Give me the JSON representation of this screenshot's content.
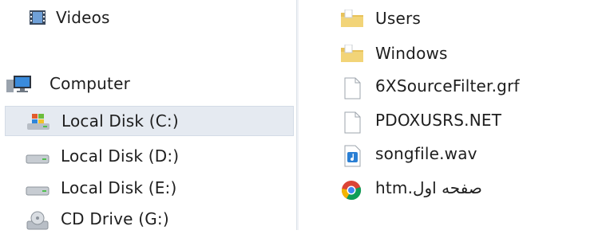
{
  "navigation": {
    "items": [
      {
        "label": "Videos",
        "icon": "videos-library-icon"
      },
      {
        "label": "Computer",
        "icon": "computer-icon"
      },
      {
        "label": "Local Disk (C:)",
        "icon": "windows-drive-icon",
        "selected": true
      },
      {
        "label": "Local Disk (D:)",
        "icon": "hard-drive-icon"
      },
      {
        "label": "Local Disk (E:)",
        "icon": "hard-drive-icon"
      },
      {
        "label": "CD Drive (G:)",
        "icon": "cd-drive-icon"
      }
    ]
  },
  "files": {
    "items": [
      {
        "name": "Users",
        "icon": "folder-icon"
      },
      {
        "name": "Windows",
        "icon": "folder-icon"
      },
      {
        "name": "6XSourceFilter.grf",
        "icon": "blank-file-icon"
      },
      {
        "name": "PDOXUSRS.NET",
        "icon": "blank-file-icon"
      },
      {
        "name": "songfile.wav",
        "icon": "audio-file-icon"
      },
      {
        "name": "صفحه اول.htm",
        "icon": "chrome-html-icon"
      }
    ]
  },
  "colors": {
    "selection": "#e5eaf1",
    "folder": "#e8c25a",
    "audio": "#2a7fd4"
  }
}
